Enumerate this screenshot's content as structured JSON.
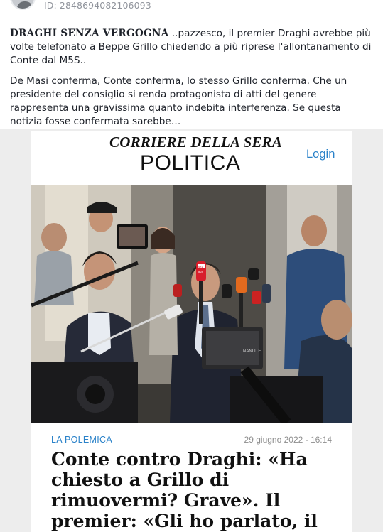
{
  "post": {
    "id_text": "ID: 2848694082106093",
    "lead_bold": "DRAGHI SENZA VERGOGNA",
    "lead_rest": " ..pazzesco, il premier Draghi avrebbe più volte telefonato a Beppe Grillo chiedendo a più riprese l'allontanamento di Conte dal M5S..",
    "second_paragraph": "De Masi conferma, Conte conferma, lo stesso Grillo conferma. Che un presidente del consiglio si renda protagonista di atti del genere rappresenta una gravissima quanto indebita interferenza. Se questa notizia fosse confermata sarebbe…"
  },
  "article": {
    "publication": "CORRIERE DELLA SERA",
    "section": "POLITICA",
    "login_label": "Login",
    "kicker": "LA POLEMICA",
    "date": "29 giugno 2022 - 16:14",
    "headline": "Conte contro Draghi: «Ha chiesto a Grillo di rimuovermi? Grave». Il premier: «Gli ho parlato, il governo non rischia"
  },
  "photo": {
    "mic_label_1": "sky",
    "mic_label_2": "tg24",
    "light_label": "NANLITE"
  }
}
